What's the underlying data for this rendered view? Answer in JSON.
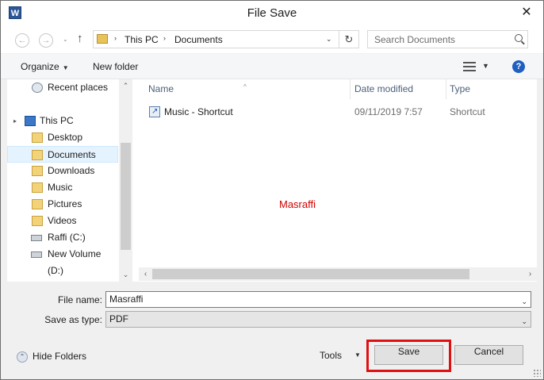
{
  "window": {
    "title": "File Save",
    "app_icon_letter": "W",
    "close_glyph": "✕"
  },
  "navigation": {
    "back_glyph": "←",
    "forward_glyph": "→",
    "dropdown_glyph": "⌄",
    "up_glyph": "↑",
    "address": {
      "segments": [
        "This PC",
        "Documents"
      ],
      "separator": "›",
      "dropdown_glyph": "⌄",
      "refresh_glyph": "↻"
    },
    "search": {
      "placeholder": "Search Documents"
    }
  },
  "toolbar": {
    "organize_label": "Organize",
    "new_folder_label": "New folder",
    "caret": "▼",
    "help_glyph": "?"
  },
  "nav_pane": {
    "items": [
      {
        "label": "Recent places",
        "icon": "recent-places-icon"
      },
      {
        "label": "This PC",
        "icon": "computer-icon"
      },
      {
        "label": "Desktop",
        "icon": "folder-icon"
      },
      {
        "label": "Documents",
        "icon": "folder-icon",
        "selected": true
      },
      {
        "label": "Downloads",
        "icon": "folder-icon"
      },
      {
        "label": "Music",
        "icon": "folder-icon"
      },
      {
        "label": "Pictures",
        "icon": "folder-icon"
      },
      {
        "label": "Videos",
        "icon": "folder-icon"
      },
      {
        "label": "Raffi (C:)",
        "icon": "drive-icon"
      },
      {
        "label": "New Volume (D:)",
        "icon": "drive-icon"
      }
    ],
    "expand_glyph": "▸",
    "scroll_up": "⌃",
    "scroll_down": "⌄"
  },
  "file_list": {
    "columns": [
      "Name",
      "Date modified",
      "Type"
    ],
    "sort_glyph": "^",
    "rows": [
      {
        "name": "Music - Shortcut",
        "date": "09/11/2019 7:57",
        "type": "Shortcut"
      }
    ],
    "watermark": "Masraffi",
    "scroll_left": "‹",
    "scroll_right": "›"
  },
  "form": {
    "file_name_label": "File name:",
    "file_name_value": "Masraffi",
    "save_type_label": "Save as type:",
    "save_type_value": "PDF",
    "dropdown_glyph": "⌄"
  },
  "footer": {
    "hide_folders_label": "Hide Folders",
    "hide_folders_glyph": "⌃",
    "tools_label": "Tools",
    "tools_caret": "▼",
    "save_label": "Save",
    "cancel_label": "Cancel"
  }
}
